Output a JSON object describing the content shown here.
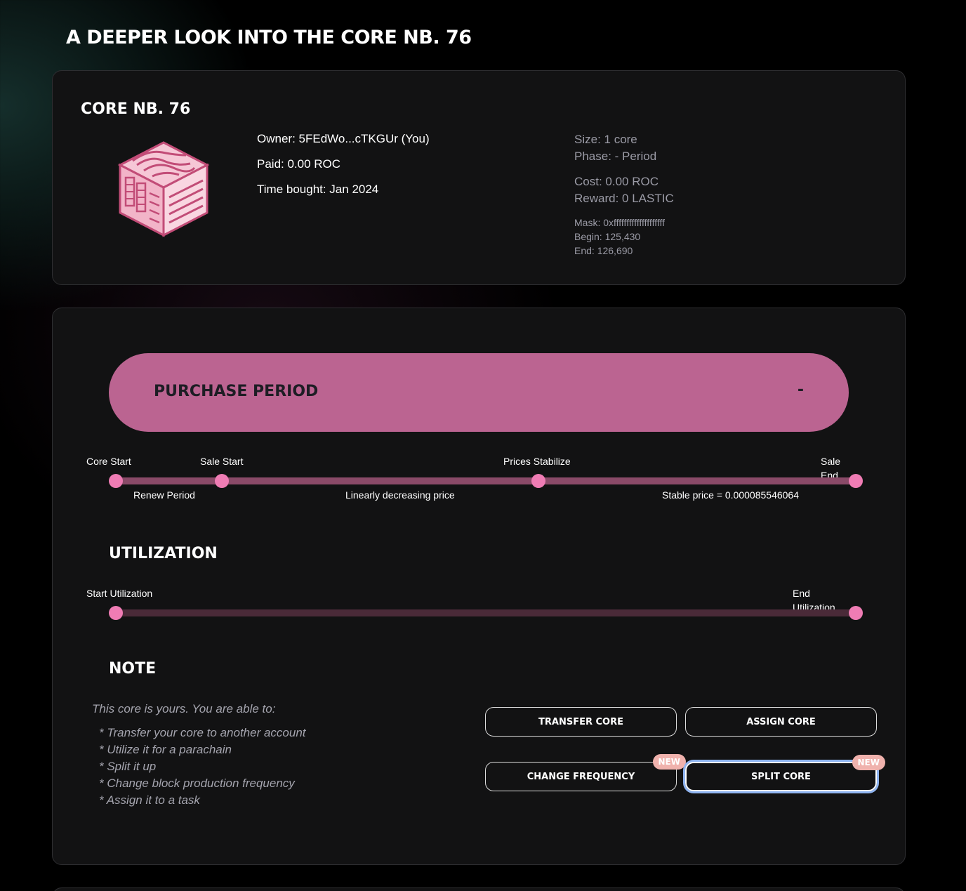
{
  "page": {
    "title": "A DEEPER LOOK INTO THE CORE NB. 76"
  },
  "core_card": {
    "title": "CORE NB. 76",
    "owner": "Owner: 5FEdWo...cTKGUr (You)",
    "paid": "Paid: 0.00 ROC",
    "time_bought": "Time bought: Jan 2024",
    "size": "Size: 1 core",
    "phase": "Phase: - Period",
    "cost": "Cost: 0.00 ROC",
    "reward": "Reward: 0 LASTIC",
    "mask": "Mask: 0xffffffffffffffffffff",
    "begin": "Begin: 125,430",
    "end": "End: 126,690"
  },
  "purchase_period": {
    "label": "PURCHASE PERIOD",
    "value": "-"
  },
  "sale_timeline": {
    "core_start": "Core Start",
    "sale_start": "Sale Start",
    "prices_stabilize": "Prices Stabilize",
    "sale_end": "Sale End",
    "renew_period": "Renew Period",
    "linear_price": "Linearly decreasing price",
    "stable_price": "Stable price = 0.000085546064"
  },
  "utilization": {
    "title": "UTILIZATION",
    "start": "Start Utilization",
    "end": "End Utilization"
  },
  "note": {
    "title": "NOTE",
    "intro": "This core is yours. You are able to:",
    "items": [
      "* Transfer your core to another account",
      "* Utilize it for a parachain",
      "* Split it up",
      "* Change block production frequency",
      "* Assign it to a task"
    ]
  },
  "actions": {
    "transfer": "TRANSFER CORE",
    "assign": "ASSIGN CORE",
    "change_frequency": "CHANGE FREQUENCY",
    "split": "SPLIT CORE",
    "new_badge": "NEW"
  },
  "colors": {
    "accent_pink": "#bb6491",
    "dot_pink": "#ef7cb4",
    "card_bg": "#121213",
    "badge": "#f0b2ad"
  }
}
